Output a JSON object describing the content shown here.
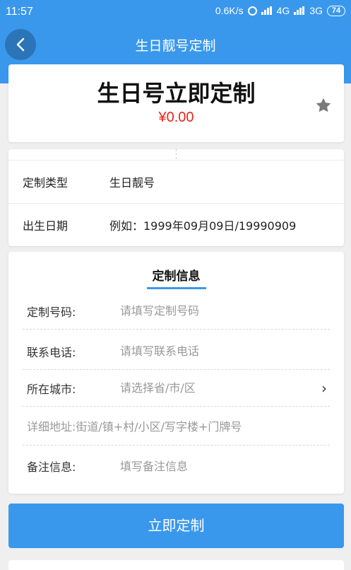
{
  "status_bar": {
    "time": "11:57",
    "speed": "0.6K/s",
    "network_a": "4G",
    "network_b": "3G",
    "battery": "74"
  },
  "nav": {
    "title": "生日靓号定制",
    "back_icon": "chevron-left-icon"
  },
  "hero": {
    "headline": "生日号立即定制",
    "price": "¥0.00",
    "favorite_icon": "star-icon"
  },
  "info": {
    "type_label": "定制类型",
    "type_value": "生日靓号",
    "date_label": "出生日期",
    "date_value": "例如：1999年09月09日/19990909"
  },
  "form": {
    "tab_label": "定制信息",
    "fields": [
      {
        "label": "定制号码:",
        "placeholder": "请填写定制号码"
      },
      {
        "label": "联系电话:",
        "placeholder": "请填写联系电话"
      },
      {
        "label": "所在城市:",
        "placeholder": "请选择省/市/区"
      },
      {
        "label": "",
        "placeholder": "详细地址:街道/镇+村/小区/写字楼+门牌号"
      },
      {
        "label": "备注信息:",
        "placeholder": "填写备注信息"
      }
    ],
    "city_chevron": "›"
  },
  "submit_label": "立即定制",
  "colors": {
    "primary": "#3a98ec",
    "price": "#e8251b"
  }
}
